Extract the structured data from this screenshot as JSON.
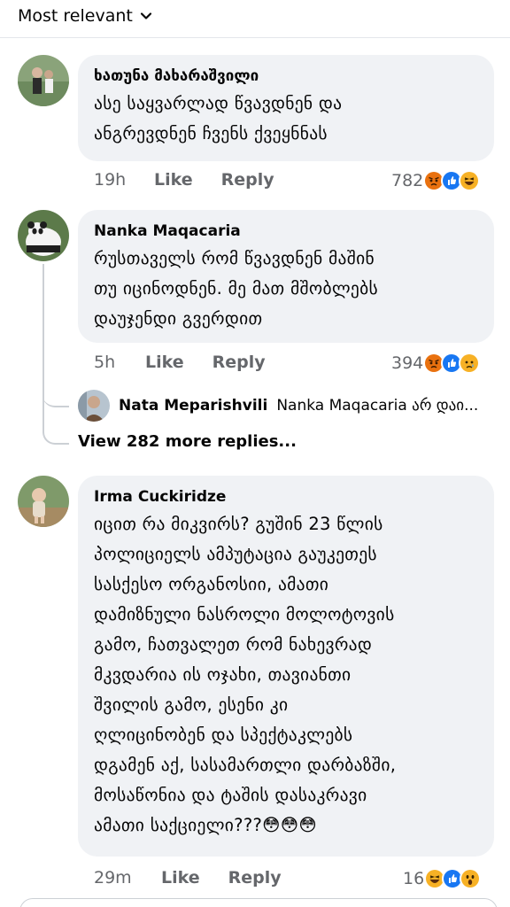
{
  "sort": {
    "label": "Most relevant"
  },
  "comments": [
    {
      "author": "ხათუნა მახარაშვილი",
      "lines": [
        "ასე საყვარლად წვავდნენ და",
        "ანგრევდნენ ჩვენს ქვეყნნას"
      ],
      "time": "19h",
      "like": "Like",
      "reply": "Reply",
      "reaction_count": "782",
      "reactions": [
        "angry-emoji",
        "like-emoji",
        "haha-emoji"
      ]
    },
    {
      "author": "Nanka Maqacaria",
      "lines": [
        "რუსთაველს რომ წვავდნენ მაშინ",
        "თუ იცინოდნენ.   მე მათ მშობლებს",
        "დაუჯენდი გვერდით"
      ],
      "time": "5h",
      "like": "Like",
      "reply": "Reply",
      "reaction_count": "394",
      "reactions": [
        "angry-emoji",
        "like-emoji",
        "sad-emoji"
      ]
    },
    {
      "author": "Irma Cuckiridze",
      "lines": [
        "იცით რა მიკვირს? გუშინ 23 წლის",
        "პოლიციელს ამპუტაცია გაუკეთეს",
        "სასქესო ორგანოსიი, ამათი",
        "დამიზნული ნასროლი მოლოტოვის",
        "გამო, ჩათვალეთ რომ ნახევრად",
        "მკვდარია ის ოჯახი, თავიანთი",
        "შვილის გამო, ესენი კი",
        "ღლიცინობენ და სპექტაკლებს",
        "დგამენ აქ, სასამართლი დარბაზში,",
        "მოსაწონია და ტაშის დასაკრავი",
        "ამათი საქციელი???😳😳😳"
      ],
      "time": "29m",
      "like": "Like",
      "reply": "Reply",
      "reaction_count": "16",
      "reactions": [
        "haha-emoji",
        "like-emoji",
        "wow-emoji"
      ]
    }
  ],
  "nested_reply": {
    "author": "Nata Meparishvili",
    "text": "Nanka Maqacaria არ დაი..."
  },
  "view_more": "View 282 more replies...",
  "colors": {
    "bubble": "#f0f2f5",
    "meta": "#65676b",
    "like_blue": "#1877f2",
    "angry": "#e9710f",
    "haha": "#f7b125"
  }
}
